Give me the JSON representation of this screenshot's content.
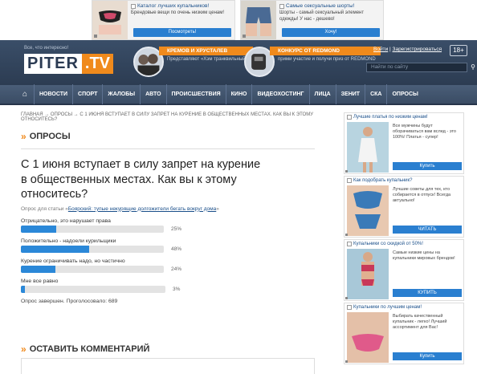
{
  "top_ads": [
    {
      "title": "Каталог лучших купальников!",
      "desc": "Брендовые вещи по очень низким ценам!",
      "button": "Посмотреть!"
    },
    {
      "title": "Самые сексуальные шорты!",
      "desc": "Шорты - самый сексуальный элемент одежды! У нас - дешево!",
      "button": "Хочу!"
    }
  ],
  "header": {
    "tagline": "Все, что интересно!",
    "logo_piter": "PITER",
    "logo_tv": ".TV",
    "promos": [
      {
        "label": "КРЕМОВ И ХРУСТАЛЕВ",
        "sub": "Представляют «Хэм транквильный»"
      },
      {
        "label": "КОНКУРС ОТ REDMOND",
        "sub": "прими участие и получи приз от REDMOND"
      }
    ],
    "login": "Войти",
    "register": "Зарегистрироваться",
    "age": "18+",
    "search_placeholder": "Найти по сайту"
  },
  "nav": [
    "НОВОСТИ",
    "СПОРТ",
    "ЖАЛОБЫ",
    "АВТО",
    "ПРОИСШЕСТВИЯ",
    "КИНО",
    "ВИДЕОХОСТИНГ",
    "ЛИЦА",
    "ЗЕНИТ",
    "СКА",
    "ОПРОСЫ"
  ],
  "breadcrumbs": "ГЛАВНАЯ  → ОПРОСЫ  → С 1 ИЮНЯ ВСТУПАЕТ В СИЛУ ЗАПРЕТ НА КУРЕНИЕ В ОБЩЕСТВЕННЫХ МЕСТАХ. КАК ВЫ К ЭТОМУ ОТНОСИТЕСЬ?",
  "section_title": "ОПРОСЫ",
  "question": "С 1 июня вступает в силу запрет на курение в общественных местах. Как вы к этому относитесь?",
  "source_prefix": "Опрос для статьи «",
  "source_link": "Боярский: тупые некурящие долгожители бегать вокруг дома",
  "source_suffix": "»",
  "poll": [
    {
      "label": "Отрицательно, это нарушает права",
      "percent": 25,
      "percent_text": "25%"
    },
    {
      "label": "Положительно - надоели курильщики",
      "percent": 48,
      "percent_text": "48%"
    },
    {
      "label": "Курение ограничивать надо, но частично",
      "percent": 24,
      "percent_text": "24%"
    },
    {
      "label": "Мне все равно",
      "percent": 3,
      "percent_text": "3%"
    }
  ],
  "poll_done": "Опрос завершен. Проголосовало: 689",
  "comment_title": "ОСТАВИТЬ КОММЕНТАРИЙ",
  "sidebar_ads": [
    {
      "title": "Лучшие платья по низким ценам!",
      "desc": "Все мужчины будут оборачиваться вам вслед - это 100%! Платья - супер!",
      "button": "Купить"
    },
    {
      "title": "Как подобрать купальник?",
      "desc": "Лучшие советы для тех, кто собирается в отпуск! Всегда актуально!",
      "button": "ЧИТАТЬ"
    },
    {
      "title": "Купальники со скидкой от 50%!",
      "desc": "Самые низкие цены на купальники мировых брендов!",
      "button": "КУПИТЬ"
    },
    {
      "title": "Купальники по лучшим ценам!",
      "desc": "Выбирать качественный купальник - легко! Лучший ассортимент для Вас!",
      "button": "Купить"
    }
  ]
}
